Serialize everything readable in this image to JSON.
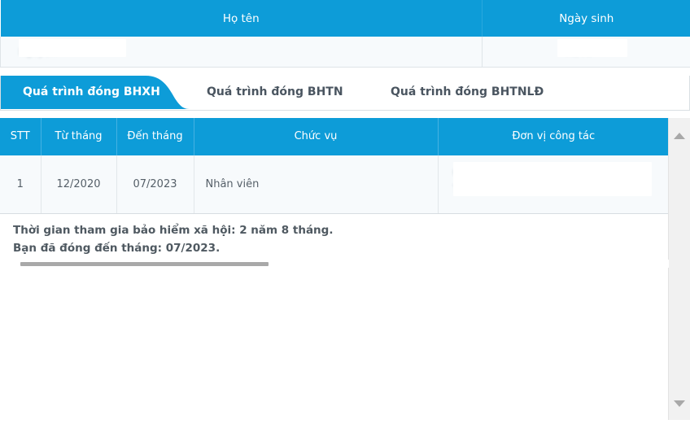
{
  "person_table": {
    "columns": [
      {
        "key": "full_name",
        "label": "Họ tên"
      },
      {
        "key": "dob",
        "label": "Ngày sinh"
      }
    ],
    "row": {
      "full_name": "",
      "dob": ""
    }
  },
  "tabs": [
    {
      "id": "bhxh",
      "label": "Quá trình đóng BHXH",
      "active": true
    },
    {
      "id": "bhtn",
      "label": "Quá trình đóng BHTN",
      "active": false
    },
    {
      "id": "bhtnld",
      "label": "Quá trình đóng BHTNLĐ",
      "active": false
    }
  ],
  "process_table": {
    "columns": [
      {
        "key": "stt",
        "label": "STT"
      },
      {
        "key": "from",
        "label": "Từ tháng"
      },
      {
        "key": "to",
        "label": "Đến tháng"
      },
      {
        "key": "position",
        "label": "Chức vụ"
      },
      {
        "key": "workplace",
        "label": "Đơn vị công tác"
      }
    ],
    "rows": [
      {
        "stt": "1",
        "from": "12/2020",
        "to": "07/2023",
        "position": "Nhân viên",
        "workplace": ""
      }
    ]
  },
  "summary": {
    "line1": "Thời gian tham gia bảo hiểm xã hội: 2 năm 8 tháng.",
    "line2": "Bạn đã đóng đến tháng: 07/2023."
  },
  "scrollbars": {
    "vertical_up_icon": "triangle-up-icon",
    "vertical_down_icon": "triangle-down-icon",
    "horizontal_thumb": "horizontal-scroll-thumb"
  },
  "colors": {
    "header_blue": "#0d9cd8",
    "row_bg": "#f7fafc",
    "text_gray": "#555f68"
  }
}
